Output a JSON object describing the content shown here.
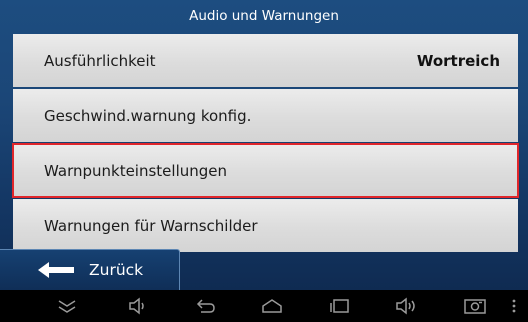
{
  "header": {
    "title": "Audio und Warnungen"
  },
  "list": {
    "items": [
      {
        "label": "Ausführlichkeit",
        "value": "Wortreich"
      },
      {
        "label": "Geschwind.warnung konfig.",
        "value": ""
      },
      {
        "label": "Warnpunkteinstellungen",
        "value": "",
        "selected": true
      },
      {
        "label": "Warnungen für Warnschilder",
        "value": ""
      }
    ]
  },
  "footer": {
    "back_label": "Zurück"
  },
  "system_nav": {
    "icons": [
      "hide-keyboard-icon",
      "volume-down-icon",
      "back-icon",
      "home-icon",
      "recent-apps-icon",
      "volume-up-icon",
      "screenshot-icon",
      "menu-icon"
    ]
  },
  "colors": {
    "highlight": "#e0262b",
    "background": "#1b4677"
  }
}
